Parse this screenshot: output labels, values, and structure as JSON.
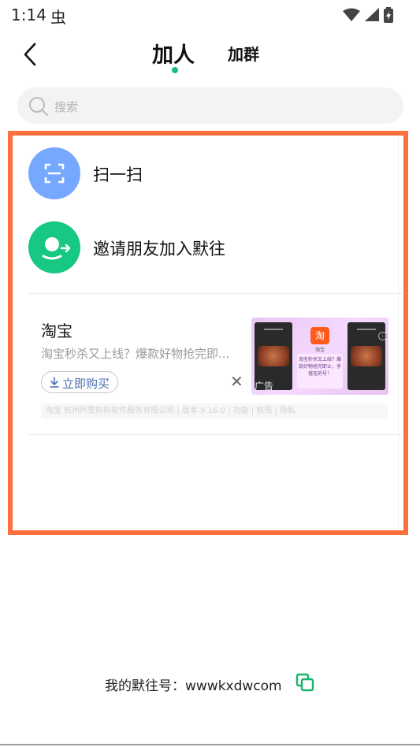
{
  "status_bar": {
    "time": "1:14",
    "bug_glyph": "虫",
    "icons": [
      "wifi-icon",
      "signal-icon",
      "battery-icon"
    ]
  },
  "header": {
    "back_icon": "chevron-left-icon",
    "tab_add_person": "加人",
    "tab_add_group": "加群",
    "active_tab": "加人",
    "accent_color": "#15c07a"
  },
  "search": {
    "placeholder": "搜索",
    "icon": "search-icon"
  },
  "options": [
    {
      "label": "扫一扫",
      "icon": "scan-icon",
      "color": "#77a8ff"
    },
    {
      "label": "邀请朋友加入默往",
      "icon": "invite-friend-icon",
      "color": "#16c882"
    }
  ],
  "ad": {
    "title": "淘宝",
    "description": "淘宝秒杀又上线？爆款好物抢完即...",
    "button_label": "立即购买",
    "close_glyph": "✕",
    "image_app_name": "淘宝",
    "image_caption": "淘宝秒杀又上线？爆款好物抢完即止，手慢无的号！",
    "image_ad_tag": "广告",
    "meta": "淘宝 杭州阿里妈妈软件服务有限公司 | 版本 9.16.0 | 功能 | 权限 | 隐私"
  },
  "my_id": {
    "label": "我的默往号：wwwkxdwcom",
    "copy_icon": "copy-icon"
  },
  "highlight_color": "#ff6f3c"
}
